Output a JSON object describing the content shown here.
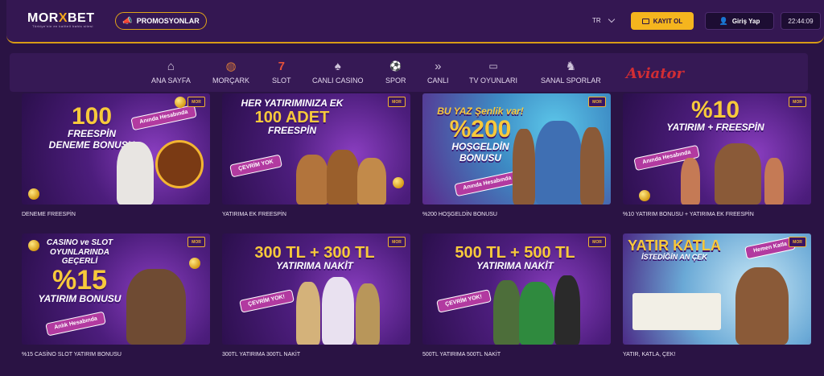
{
  "header": {
    "logo_text_a": "MOR",
    "logo_text_x": "X",
    "logo_text_b": "BET",
    "logo_tagline": "Türkiye'nin en kaliteli bahis sitesi",
    "promo_label": "PROMOSYONLAR",
    "language": "TR",
    "register_label": "KAYIT OL",
    "login_label": "Giriş Yap",
    "clock": "22:44:09"
  },
  "nav": {
    "items": [
      {
        "label": "ANA SAYFA",
        "icon": "home-icon"
      },
      {
        "label": "MORÇARK",
        "icon": "wheel-icon"
      },
      {
        "label": "SLOT",
        "icon": "seven-icon"
      },
      {
        "label": "CANLI CASINO",
        "icon": "spade-icon"
      },
      {
        "label": "SPOR",
        "icon": "football-icon"
      },
      {
        "label": "CANLI",
        "icon": "live-icon"
      },
      {
        "label": "TV OYUNLARI",
        "icon": "tv-icon"
      },
      {
        "label": "SANAL SPORLAR",
        "icon": "horse-icon"
      }
    ],
    "aviator": "Aviator"
  },
  "promos": [
    {
      "caption": "DENEME FREESPİN",
      "big": "100",
      "line1": "FREESPİN",
      "line2": "DENEME BONUSU",
      "pill": "Anında Hesabında",
      "badge": "MOR"
    },
    {
      "caption": "YATIRIMA EK FREESPİN",
      "big": "100 ADET",
      "line1": "HER YATIRIMINIZA EK",
      "line2": "FREESPİN",
      "pill": "ÇEVRİM YOK",
      "badge": "MOR"
    },
    {
      "caption": "%200 HOŞGELDİN BONUSU",
      "big": "%200",
      "line1": "BU YAZ Şenlik var!",
      "line2": "HOŞGELDİN BONUSU",
      "pill": "Anında Hesabında",
      "badge": "MOR"
    },
    {
      "caption": "%10 YATIRIM BONUSU + YATIRIMA EK FREESPİN",
      "big": "%10",
      "line1": "YATIRIM + FREESPİN",
      "line2": "",
      "pill": "Anında Hesabında",
      "badge": "MOR"
    },
    {
      "caption": "%15 CASİNO SLOT YATIRIM BONUSU",
      "big": "%15",
      "line1": "CASINO ve SLOT OYUNLARINDA GEÇERLİ",
      "line2": "YATIRIM BONUSU",
      "pill": "Anlık Hesabında",
      "badge": "MOR"
    },
    {
      "caption": "300TL YATIRIMA 300TL NAKİT",
      "big": "300 TL + 300 TL",
      "line1": "YATIRIMA   NAKİT",
      "line2": "",
      "pill": "ÇEVRİM YOK!",
      "badge": "MOR"
    },
    {
      "caption": "500TL YATIRIMA 500TL NAKİT",
      "big": "500 TL + 500 TL",
      "line1": "YATIRIMA   NAKİT",
      "line2": "",
      "pill": "ÇEVRİM YOK!",
      "badge": "MOR"
    },
    {
      "caption": "YATIR, KATLA, ÇEK!",
      "big": "YATIR KATLA",
      "line1": "İSTEDİĞİN AN ÇEK",
      "line2": "",
      "pill": "Hemen Katla",
      "badge": "MOR"
    }
  ],
  "colors": {
    "accent": "#f5b51e",
    "background": "#2a1344",
    "panel": "#361955"
  }
}
